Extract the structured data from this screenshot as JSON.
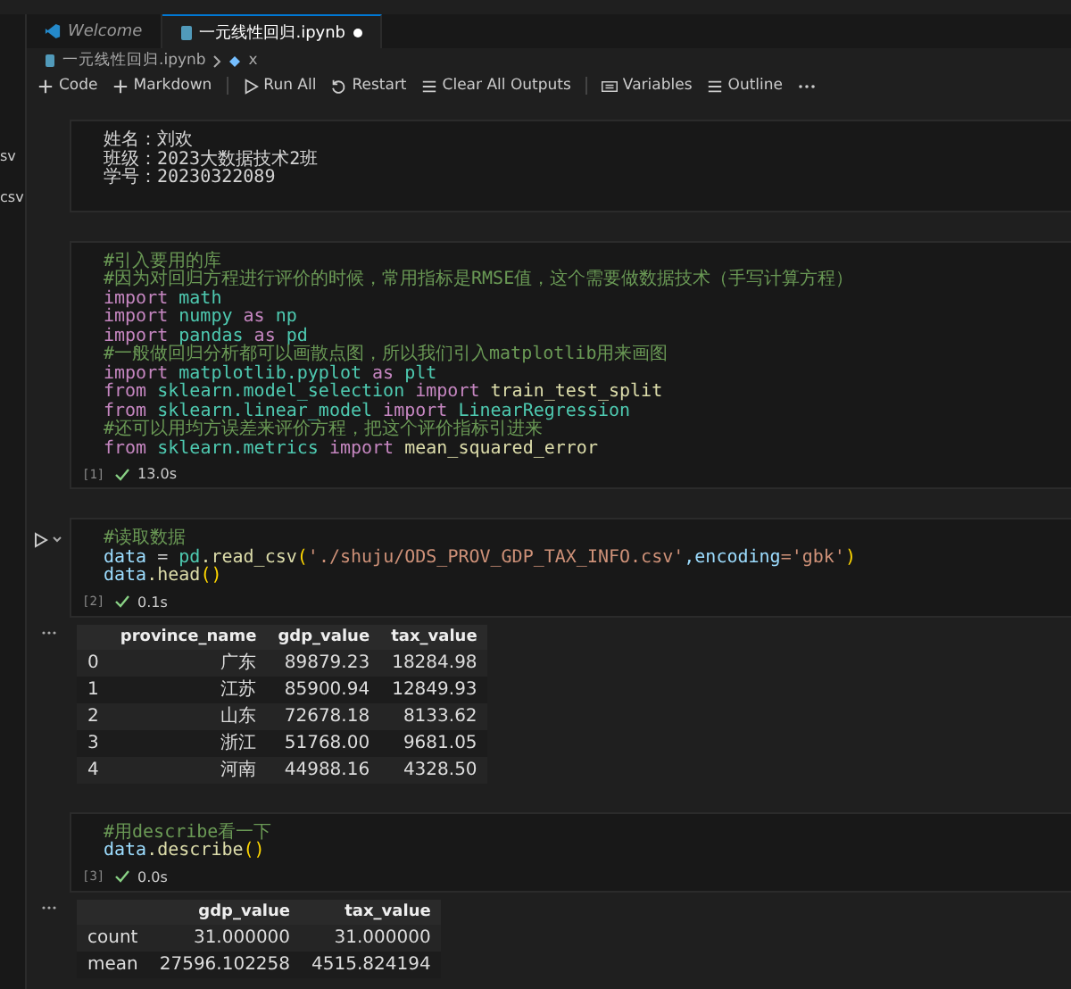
{
  "explorer_items": [
    "sv",
    "csv"
  ],
  "tabs": [
    {
      "label": "Welcome",
      "selected": false,
      "modified": false,
      "kind": "welcome"
    },
    {
      "label": "一元线性回归.ipynb",
      "selected": true,
      "modified": true,
      "kind": "notebook"
    }
  ],
  "breadcrumb": [
    {
      "label": "一元线性回归.ipynb",
      "kind": "file"
    },
    {
      "label": "x",
      "kind": "symbol"
    }
  ],
  "toolbar": [
    {
      "label": "Code",
      "kind": "plus"
    },
    {
      "label": "Markdown",
      "kind": "plus"
    },
    {
      "kind": "separator"
    },
    {
      "label": "Run All",
      "kind": "run"
    },
    {
      "label": "Restart",
      "kind": "restart"
    },
    {
      "label": "Clear All Outputs",
      "kind": "clear"
    },
    {
      "kind": "separator"
    },
    {
      "label": "Variables",
      "kind": "variables"
    },
    {
      "label": "Outline",
      "kind": "outline"
    },
    {
      "kind": "more"
    }
  ],
  "cells": [
    {
      "kind": "markdown",
      "lines": [
        "姓名：刘欢",
        "班级：2023大数据技术2班",
        "学号：20230322089"
      ]
    },
    {
      "kind": "code",
      "exec_count": "[1]",
      "status": "13.0s",
      "lines": [
        [
          {
            "kind": "comment",
            "text": "#引入要用的库"
          }
        ],
        [
          {
            "kind": "comment",
            "text": "#因为对回归方程进行评价的时候，常用指标是RMSE值，这个需要做数据技术（手写计算方程）"
          }
        ],
        [
          {
            "kind": "keyword",
            "text": "import"
          },
          {
            "kind": "module",
            "text": " math"
          }
        ],
        [
          {
            "kind": "keyword",
            "text": "import"
          },
          {
            "kind": "module",
            "text": " numpy"
          },
          {
            "kind": "keyword",
            "text": " as"
          },
          {
            "kind": "module",
            "text": " np"
          }
        ],
        [
          {
            "kind": "keyword",
            "text": "import"
          },
          {
            "kind": "module",
            "text": " pandas"
          },
          {
            "kind": "keyword",
            "text": " as"
          },
          {
            "kind": "module",
            "text": " pd"
          }
        ],
        [
          {
            "kind": "comment",
            "text": "#一般做回归分析都可以画散点图，所以我们引入matplotlib用来画图"
          }
        ],
        [
          {
            "kind": "keyword",
            "text": "import"
          },
          {
            "kind": "module",
            "text": " matplotlib.pyplot"
          },
          {
            "kind": "keyword",
            "text": " as"
          },
          {
            "kind": "module",
            "text": " plt"
          }
        ],
        [
          {
            "kind": "keyword",
            "text": "from"
          },
          {
            "kind": "module",
            "text": " sklearn.model_selection"
          },
          {
            "kind": "keyword",
            "text": " import"
          },
          {
            "kind": "function",
            "text": " train_test_split"
          }
        ],
        [
          {
            "kind": "keyword",
            "text": "from"
          },
          {
            "kind": "module",
            "text": " sklearn.linear_model"
          },
          {
            "kind": "keyword",
            "text": " import"
          },
          {
            "kind": "module",
            "text": " LinearRegression"
          }
        ],
        [
          {
            "kind": "comment",
            "text": "#还可以用均方误差来评价方程，把这个评价指标引进来"
          }
        ],
        [
          {
            "kind": "keyword",
            "text": "from"
          },
          {
            "kind": "module",
            "text": " sklearn.metrics"
          },
          {
            "kind": "keyword",
            "text": " import"
          },
          {
            "kind": "function",
            "text": " mean_squared_error"
          }
        ]
      ]
    },
    {
      "kind": "code",
      "run_button": true,
      "exec_count": "[2]",
      "status": "0.1s",
      "lines": [
        [
          {
            "kind": "comment",
            "text": "#读取数据"
          }
        ],
        [
          {
            "kind": "variable",
            "text": "data"
          },
          {
            "kind": "plain",
            "text": " = "
          },
          {
            "kind": "module",
            "text": "pd"
          },
          {
            "kind": "function",
            "text": ".read_csv"
          },
          {
            "kind": "bracket",
            "text": "("
          },
          {
            "kind": "string",
            "text": "'./shuju/ODS_PROV_GDP_TAX_INFO.csv'"
          },
          {
            "kind": "variable",
            "text": ",encoding"
          },
          {
            "kind": "string",
            "text": "='gbk'"
          },
          {
            "kind": "bracket",
            "text": ")"
          }
        ],
        [
          {
            "kind": "variable",
            "text": "data"
          },
          {
            "kind": "function",
            "text": ".head"
          },
          {
            "kind": "bracket",
            "text": "()"
          }
        ]
      ],
      "output": {
        "columns": [
          "",
          "province_name",
          "gdp_value",
          "tax_value"
        ],
        "rows": [
          [
            "0",
            "广东",
            "89879.23",
            "18284.98"
          ],
          [
            "1",
            "江苏",
            "85900.94",
            "12849.93"
          ],
          [
            "2",
            "山东",
            "72678.18",
            "8133.62"
          ],
          [
            "3",
            "浙江",
            "51768.00",
            "9681.05"
          ],
          [
            "4",
            "河南",
            "44988.16",
            "4328.50"
          ]
        ]
      }
    },
    {
      "kind": "code",
      "exec_count": "[3]",
      "status": "0.0s",
      "lines": [
        [
          {
            "kind": "comment",
            "text": "#用describe看一下"
          }
        ],
        [
          {
            "kind": "variable",
            "text": "data"
          },
          {
            "kind": "function",
            "text": ".describe"
          },
          {
            "kind": "bracket",
            "text": "()"
          }
        ]
      ],
      "output": {
        "columns": [
          "",
          "gdp_value",
          "tax_value"
        ],
        "rows": [
          [
            "count",
            "31.000000",
            "31.000000"
          ],
          [
            "mean",
            "27596.102258",
            "4515.824194"
          ]
        ]
      }
    }
  ]
}
